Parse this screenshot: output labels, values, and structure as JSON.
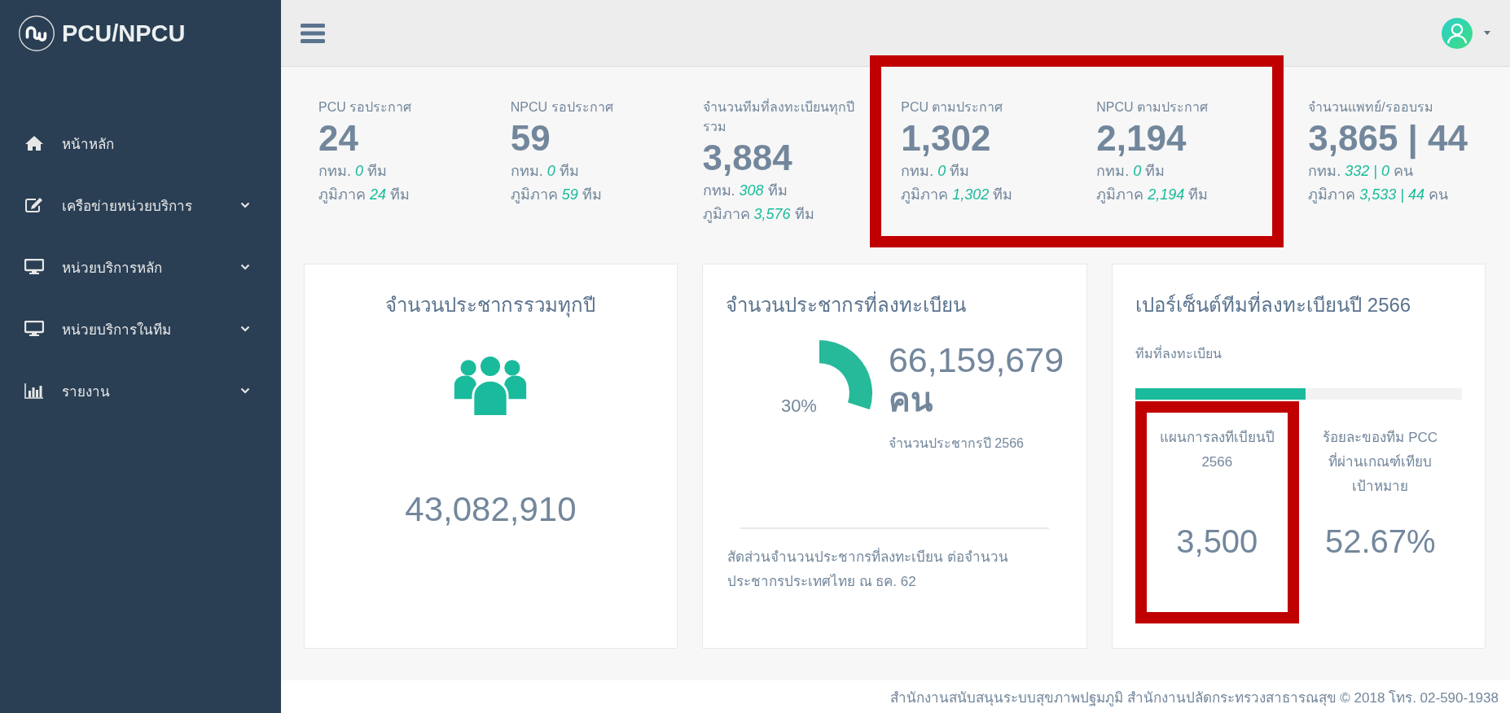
{
  "brand": {
    "title": "PCU/NPCU"
  },
  "sidebar": {
    "items": [
      {
        "label": "หน้าหลัก",
        "kind": "home",
        "expandable": false
      },
      {
        "label": "เครือข่ายหน่วยบริการ",
        "kind": "edit",
        "expandable": true
      },
      {
        "label": "หน่วยบริการหลัก",
        "kind": "desktop",
        "expandable": true
      },
      {
        "label": "หน่วยบริการในทีม",
        "kind": "desktop",
        "expandable": true
      },
      {
        "label": "รายงาน",
        "kind": "chart",
        "expandable": true
      }
    ]
  },
  "stats": [
    {
      "label": "PCU รอประกาศ",
      "value": "24",
      "lines": [
        "กทม. *0* ทีม",
        "ภูมิภาค *24* ทีม"
      ],
      "highlighted": false
    },
    {
      "label": "NPCU รอประกาศ",
      "value": "59",
      "lines": [
        "กทม. *0* ทีม",
        "ภูมิภาค *59* ทีม"
      ],
      "highlighted": false
    },
    {
      "label": "จำนวนทีมที่ลงทะเบียนทุกปีรวม",
      "value": "3,884",
      "lines": [
        "กทม. *308* ทีม",
        "ภูมิภาค *3,576* ทีม"
      ],
      "highlighted": false
    },
    {
      "label": "PCU ตามประกาศ",
      "value": "1,302",
      "lines": [
        "กทม. *0* ทีม",
        "ภูมิภาค *1,302* ทีม"
      ],
      "highlighted": true
    },
    {
      "label": "NPCU ตามประกาศ",
      "value": "2,194",
      "lines": [
        "กทม. *0* ทีม",
        "ภูมิภาค *2,194* ทีม"
      ],
      "highlighted": true
    },
    {
      "label": "จำนวนแพทย์/รออบรม",
      "value": "3,865 | 44",
      "lines": [
        "กทม. *332 | 0* คน",
        "ภูมิภาค *3,533 | 44* คน"
      ],
      "highlighted": false
    }
  ],
  "cards": [
    {
      "kind": "people",
      "title": "จำนวนประชากรรวมทุกปี",
      "value": "43,082,910"
    },
    {
      "kind": "gauge",
      "title": "จำนวนประชากรที่ลงทะเบียน",
      "level": 0.3,
      "percent": "30%",
      "value": "66,159,679",
      "unit": "คน",
      "caption": "จำนวนประชากรปี 2566",
      "note": "สัดส่วนจำนวนประชากรที่ลงทะเบียน ต่อจำนวนประชากรประเทศไทย ณ ธค. 62"
    },
    {
      "kind": "progress",
      "title": "เปอร์เซ็นต์ทีมที่ลงทะเบียนปี 2566",
      "bar_label": "ทีมที่ลงทะเบียน",
      "level": 0.52,
      "blocks": [
        {
          "label": "แผนการลงทีเบียนปี 2566",
          "value": "3,500",
          "highlighted": true
        },
        {
          "label": "ร้อยละของทีม PCC ที่ผ่านเกณฑ์เทียบเป้าหมาย",
          "value": "52.67%",
          "highlighted": false
        }
      ]
    }
  ],
  "footer": "สำนักงานสนับสนุนระบบสุขภาพปฐมภูมิ สำนักงานปลัดกระทรวงสาธารณสุข © 2018 โทร. 02-590-1938"
}
